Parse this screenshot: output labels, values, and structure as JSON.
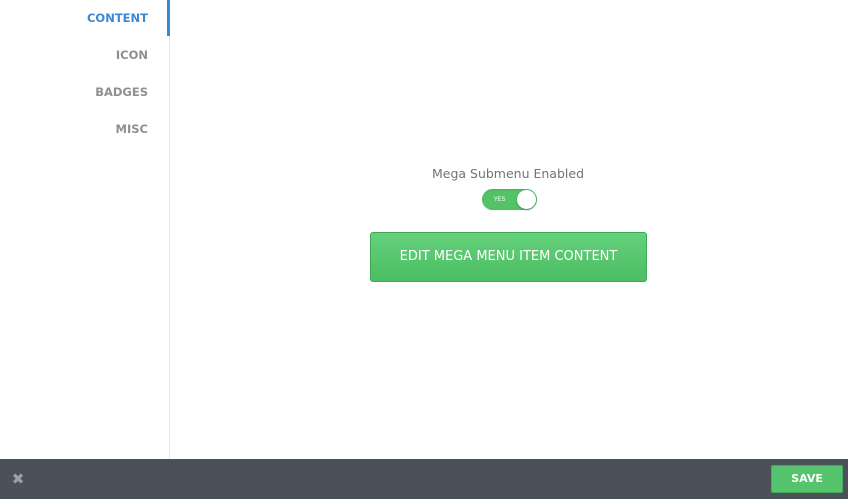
{
  "sidebar": {
    "tabs": [
      {
        "label": "CONTENT"
      },
      {
        "label": "ICON"
      },
      {
        "label": "BADGES"
      },
      {
        "label": "MISC"
      }
    ]
  },
  "main": {
    "field_label": "Mega Submenu Enabled",
    "toggle": {
      "text": "YES",
      "on": true
    },
    "edit_button_label": "EDIT MEGA MENU ITEM CONTENT"
  },
  "footer": {
    "close_icon": "close-icon",
    "close_glyph": "✖",
    "save_label": "SAVE"
  },
  "colors": {
    "accent_blue": "#3a87d8",
    "green": "#52c467",
    "footer_bg": "#4a5158"
  }
}
